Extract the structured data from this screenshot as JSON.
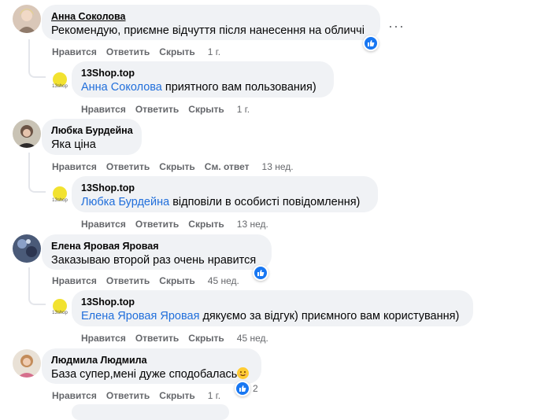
{
  "actions": {
    "like": "Нравится",
    "reply": "Ответить",
    "hide": "Скрыть",
    "see_reply": "См. ответ"
  },
  "comments": [
    {
      "author": "Анна Соколова",
      "text": "Рекомендую, приємне відчуття після нанесення на обличчі",
      "time": "1 г."
    },
    {
      "author": "13Shop.top",
      "mention": "Анна Соколова",
      "text": " приятного вам пользования)",
      "time": "1 г."
    },
    {
      "author": "Любка Бурдейна",
      "text": "Яка ціна",
      "time": "13 нед."
    },
    {
      "author": "13Shop.top",
      "mention": "Любка Бурдейна",
      "text": " відповіли в особисті повідомлення)",
      "time": "13 нед."
    },
    {
      "author": "Елена Яровая Яровая",
      "text": "Заказываю второй раз очень нравится",
      "time": "45 нед."
    },
    {
      "author": "13Shop.top",
      "mention": "Елена Яровая Яровая",
      "text": " дякуємо за відгук) приємного вам користування)",
      "time": "45 нед."
    },
    {
      "author": "Людмила Людмила",
      "text": "База супер,мені дуже сподобалась",
      "time": "1 г.",
      "likes": "2"
    }
  ],
  "colors": {
    "link": "#216fdb",
    "like": "#1877f2",
    "bubble": "#f0f2f5"
  }
}
